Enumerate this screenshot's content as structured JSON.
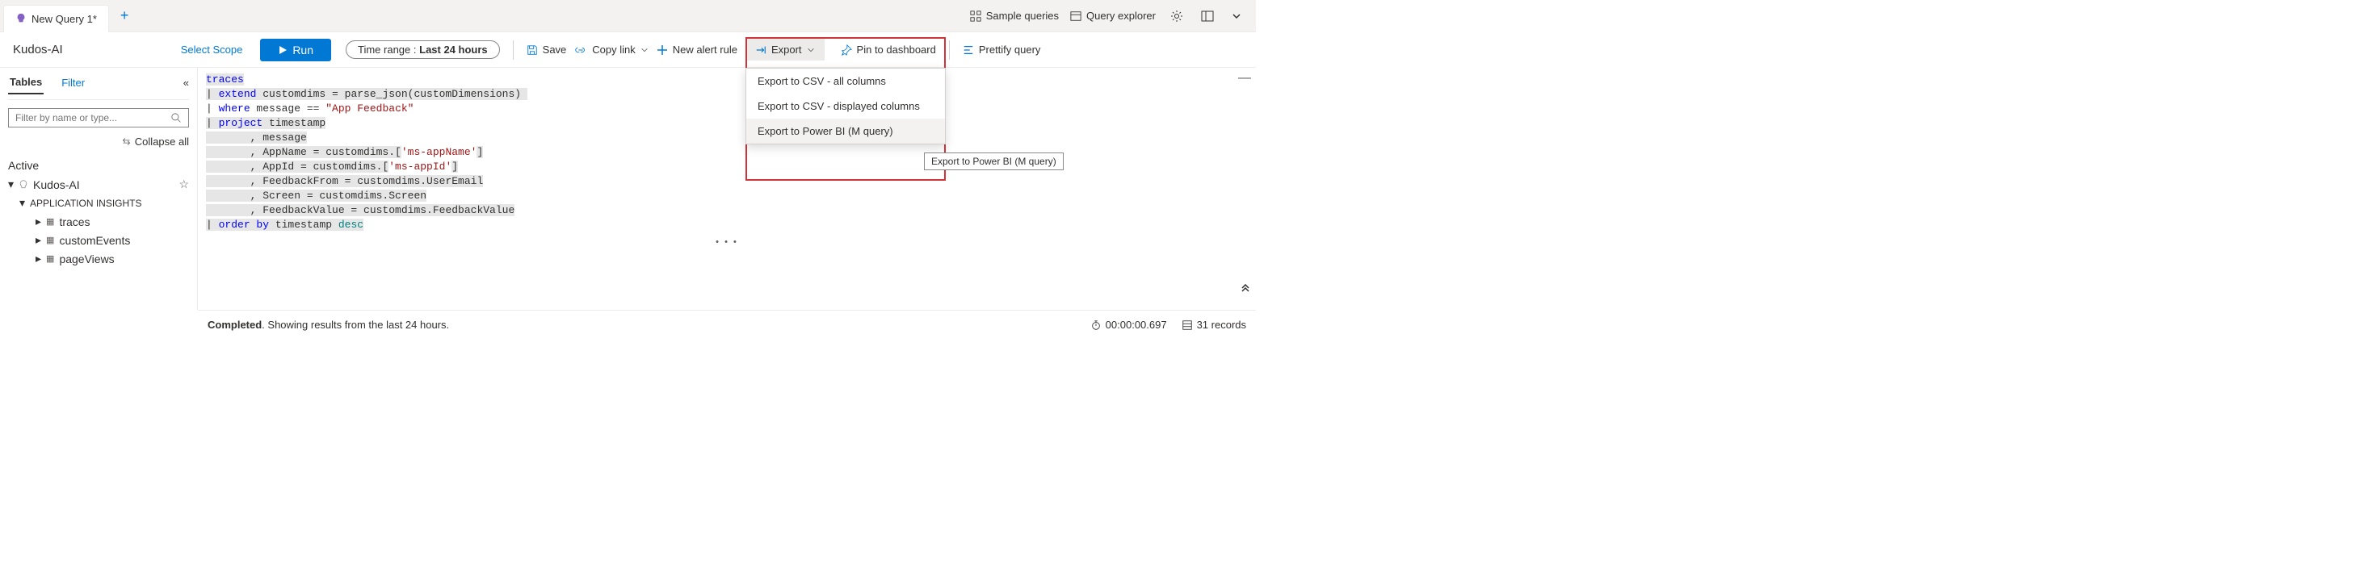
{
  "tabs": {
    "active": "New Query 1*",
    "add": "+"
  },
  "top_right": {
    "sample": "Sample queries",
    "explorer": "Query explorer"
  },
  "toolbar": {
    "title": "Kudos-AI",
    "select_scope": "Select Scope",
    "run": "Run",
    "time_label": "Time range :",
    "time_value": "Last 24 hours",
    "save": "Save",
    "copy": "Copy link",
    "new_alert": "New alert rule",
    "export": "Export",
    "pin": "Pin to dashboard",
    "prettify": "Prettify query"
  },
  "export_menu": {
    "csv_all": "Export to CSV - all columns",
    "csv_disp": "Export to CSV - displayed columns",
    "pbi": "Export to Power BI (M query)",
    "tooltip": "Export to Power BI (M query)"
  },
  "sidebar": {
    "tabs": {
      "tables": "Tables",
      "filter": "Filter"
    },
    "search_placeholder": "Filter by name or type...",
    "collapse": "Collapse all",
    "active_label": "Active",
    "root": "Kudos-AI",
    "group": "APPLICATION INSIGHTS",
    "items": [
      "traces",
      "customEvents",
      "pageViews"
    ]
  },
  "query": {
    "l1": "traces",
    "l2a": "extend",
    "l2b": " customdims = parse_json(customDimensions) ",
    "l3a": "where",
    "l3b": " message == ",
    "l3c": "\"App Feedback\"",
    "l4a": "project",
    "l4b": " timestamp",
    "l5": "       , message",
    "l6a": "       , AppName = customdims.[",
    "l6b": "'ms-appName'",
    "l6c": "]",
    "l7a": "       , AppId = customdims.[",
    "l7b": "'ms-appId'",
    "l7c": "]",
    "l8": "       , FeedbackFrom = customdims.UserEmail",
    "l9": "       , Screen = customdims.Screen",
    "l10": "       , FeedbackValue = customdims.FeedbackValue",
    "l11a": "order by",
    "l11b": " timestamp ",
    "l11c": "desc"
  },
  "status": {
    "completed": "Completed",
    "text": ". Showing results from the last 24 hours.",
    "time": "00:00:00.697",
    "records": "31 records"
  }
}
